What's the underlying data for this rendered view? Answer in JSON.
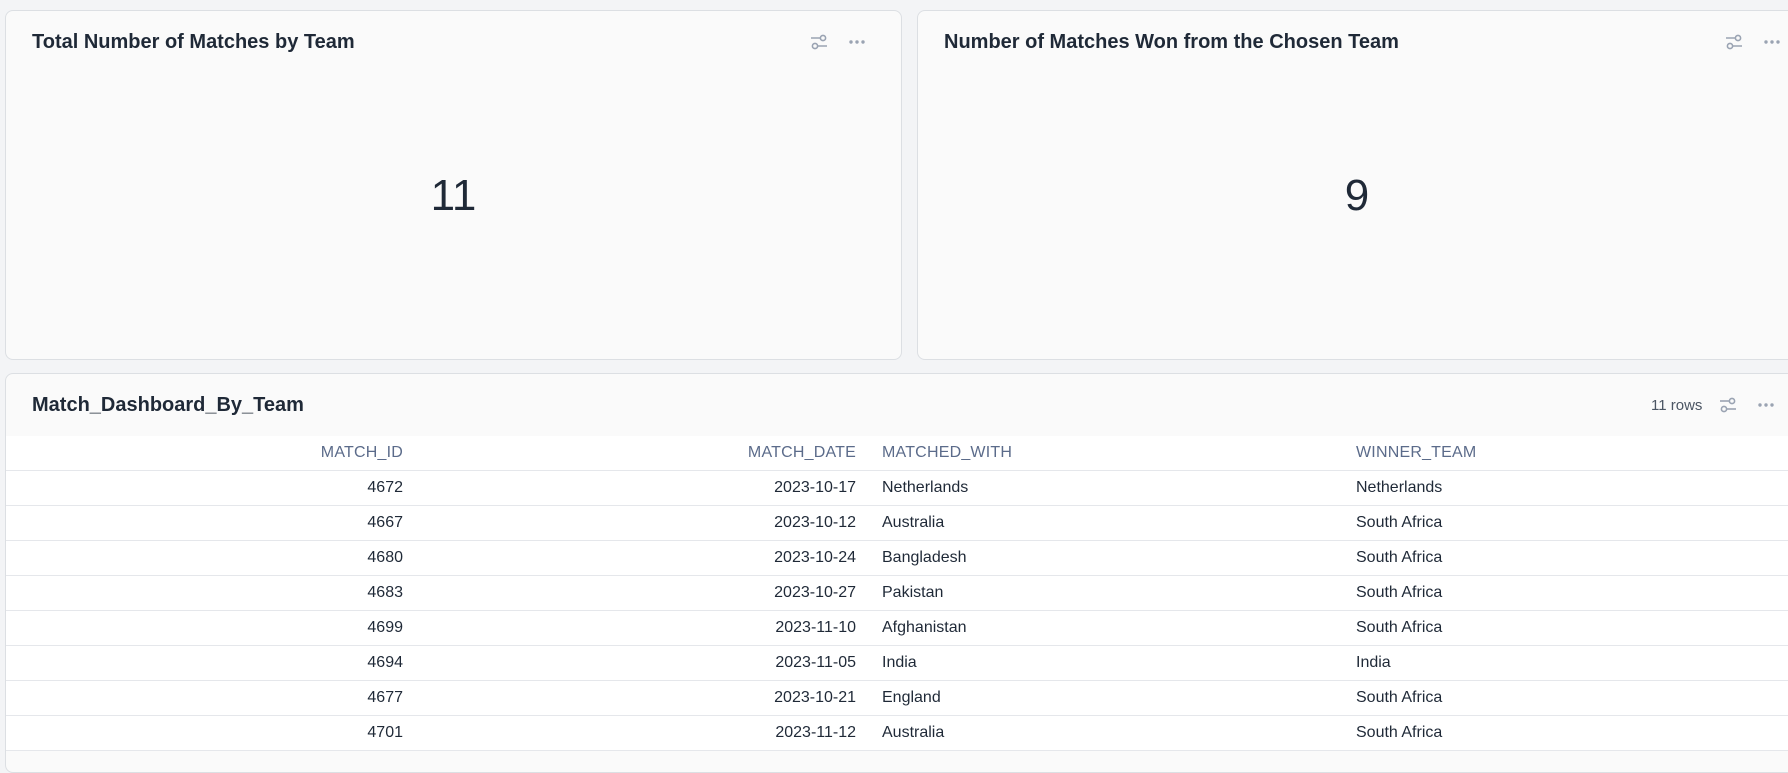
{
  "kpi_total": {
    "title": "Total Number of Matches by Team",
    "value": "11"
  },
  "kpi_won": {
    "title": "Number of Matches Won from the Chosen Team",
    "value": "9"
  },
  "table_card": {
    "title": "Match_Dashboard_By_Team",
    "row_count": "11 rows",
    "columns": [
      "MATCH_ID",
      "MATCH_DATE",
      "MATCHED_WITH",
      "WINNER_TEAM"
    ],
    "rows": [
      [
        "4672",
        "2023-10-17",
        "Netherlands",
        "Netherlands"
      ],
      [
        "4667",
        "2023-10-12",
        "Australia",
        "South Africa"
      ],
      [
        "4680",
        "2023-10-24",
        "Bangladesh",
        "South Africa"
      ],
      [
        "4683",
        "2023-10-27",
        "Pakistan",
        "South Africa"
      ],
      [
        "4699",
        "2023-11-10",
        "Afghanistan",
        "South Africa"
      ],
      [
        "4694",
        "2023-11-05",
        "India",
        "India"
      ],
      [
        "4677",
        "2023-10-21",
        "England",
        "South Africa"
      ],
      [
        "4701",
        "2023-11-12",
        "Australia",
        "South Africa"
      ]
    ]
  },
  "icons": {
    "settings": "sliders-icon",
    "more": "more-horizontal-icon"
  }
}
